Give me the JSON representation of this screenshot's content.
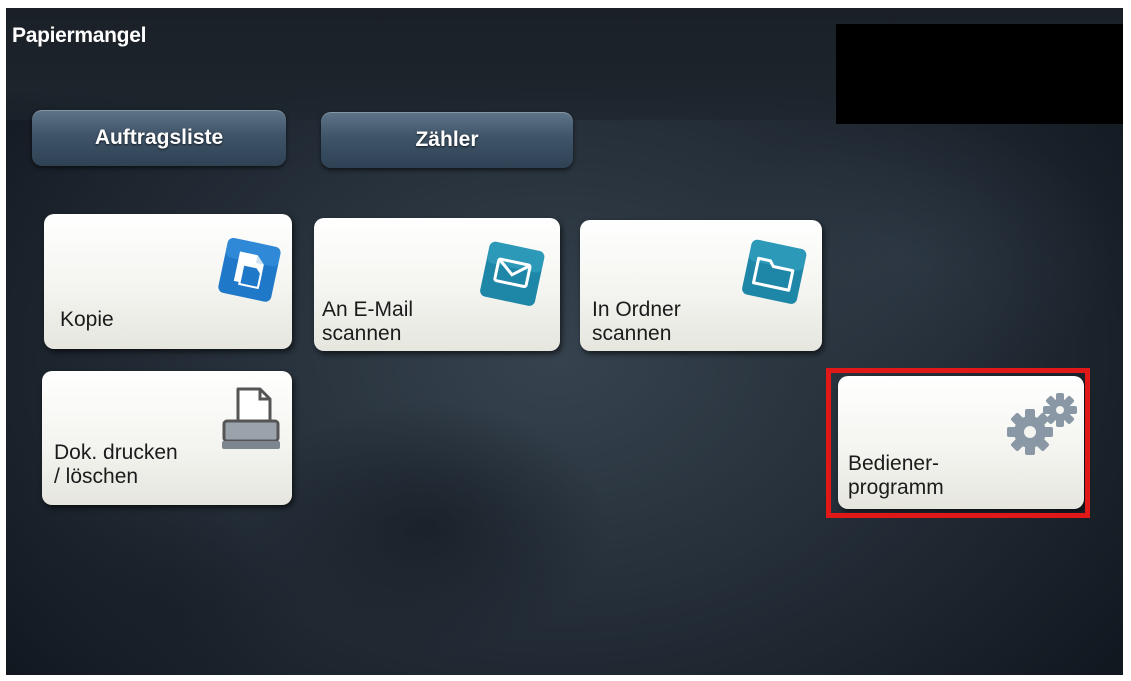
{
  "status": {
    "message": "Papiermangel"
  },
  "top_buttons": {
    "jobs_label": "Auftragsliste",
    "counter_label": "Zähler"
  },
  "tiles": {
    "copy": {
      "label": "Kopie",
      "icon": "copy-document-icon"
    },
    "scan_email": {
      "label": "An E-Mail\nscannen",
      "icon": "envelope-icon"
    },
    "scan_folder": {
      "label": "In Ordner\nscannen",
      "icon": "folder-icon"
    },
    "print_delete": {
      "label": "Dok. drucken\n/ löschen",
      "icon": "printer-icon"
    },
    "utility": {
      "label": "Bediener-\nprogramm",
      "icon": "gears-icon"
    }
  },
  "highlight": {
    "target": "utility",
    "color": "#e01818"
  },
  "colors": {
    "accent_blue": "#1f78c8",
    "teal_icon": "#1e86a6",
    "button_blue": "#3f5468"
  }
}
